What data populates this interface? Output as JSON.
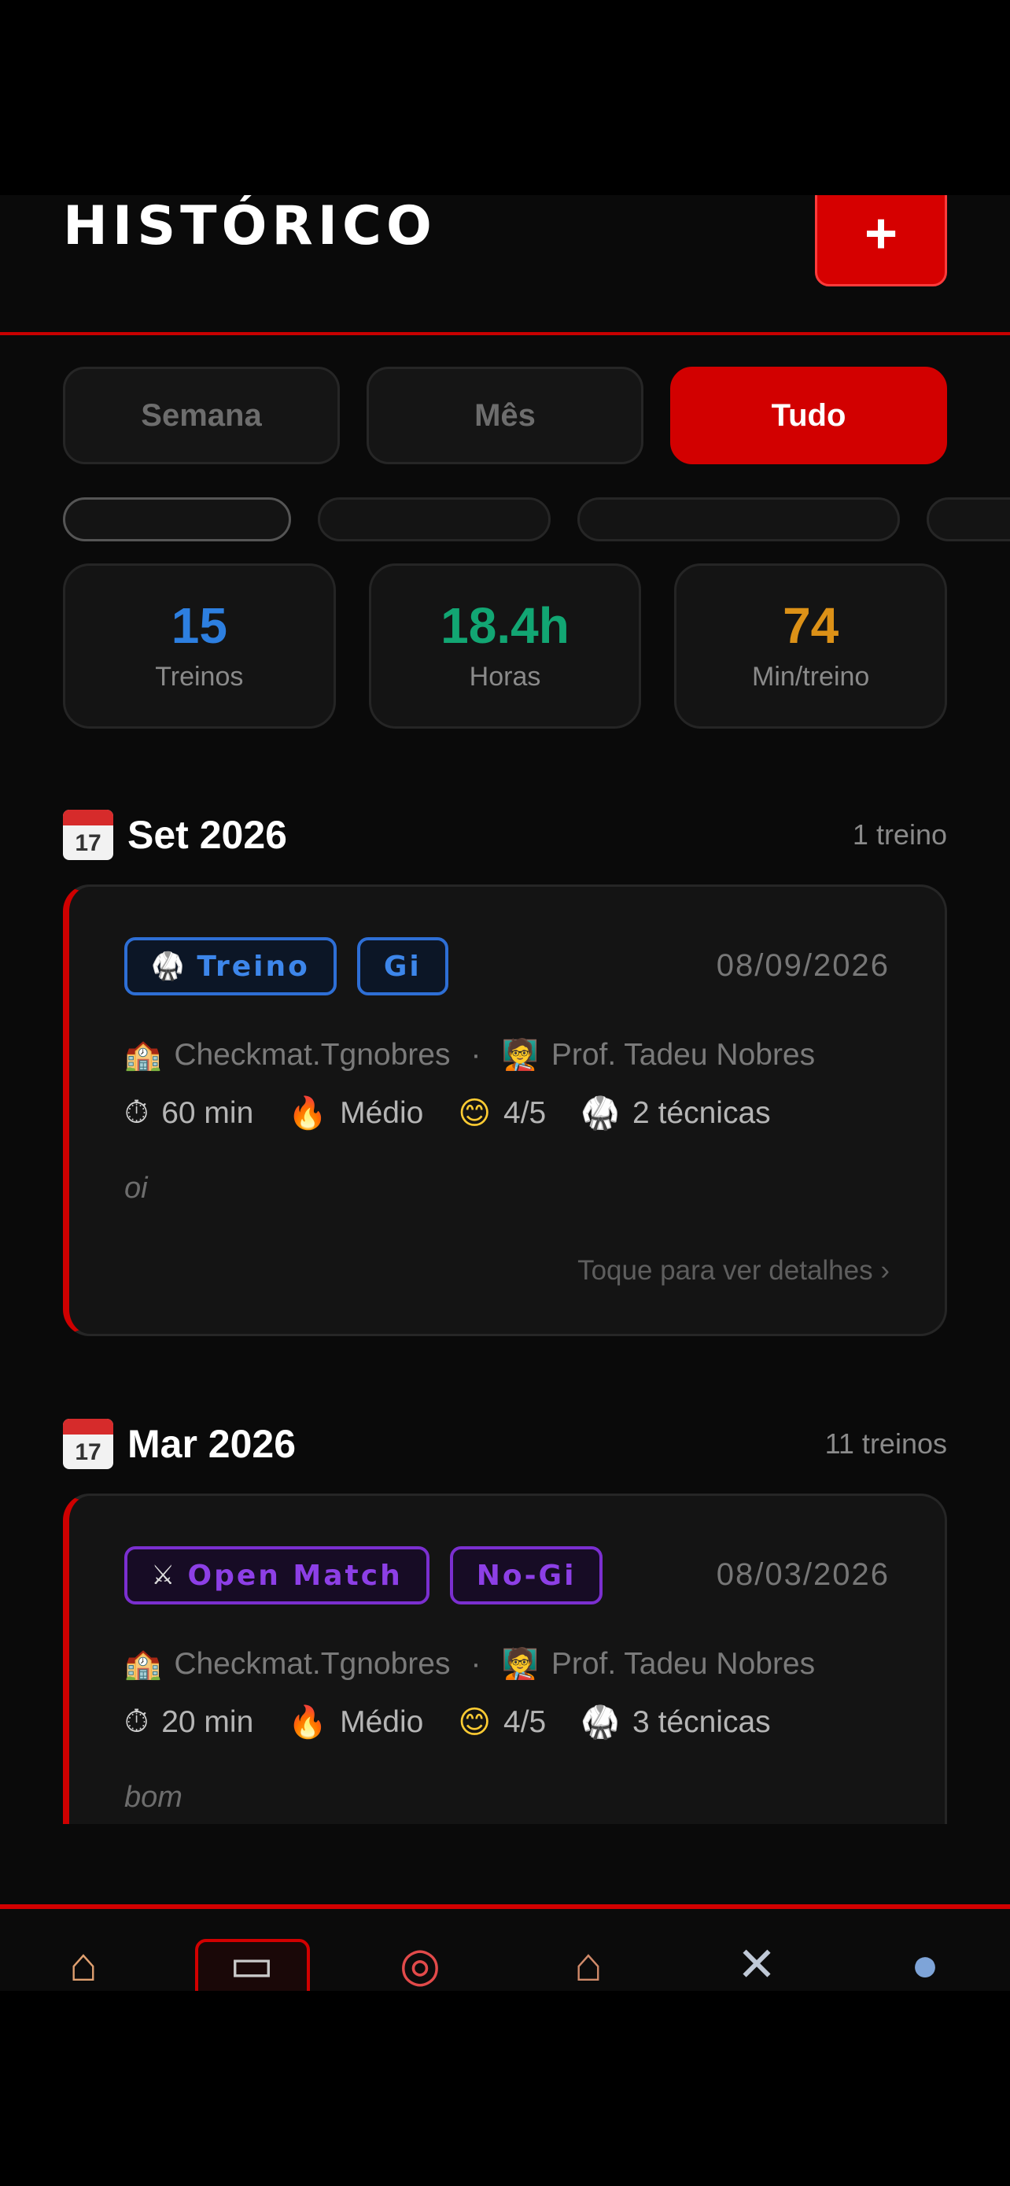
{
  "header": {
    "title": "HISTÓRICO",
    "add_label": "+"
  },
  "tabs": [
    {
      "label": "Semana"
    },
    {
      "label": "Mês"
    },
    {
      "label": "Tudo"
    }
  ],
  "stats": [
    {
      "value": "15",
      "label": "Treinos",
      "color": "#2d7fe0"
    },
    {
      "value": "18.4h",
      "label": "Horas",
      "color": "#12a673"
    },
    {
      "value": "74",
      "label": "Min/treino",
      "color": "#dc9117"
    }
  ],
  "sections": [
    {
      "calendar_icon": "JUL 17",
      "month": "Set 2026",
      "count": "1 treino",
      "card": {
        "type_badge": "Treino",
        "type_icon": "gi-icon",
        "style_badge": "Gi",
        "date": "08/09/2026",
        "academy": "Checkmat.Tgnobres",
        "separator": "·",
        "professor": "Prof. Tadeu Nobres",
        "duration": "60 min",
        "intensity": "Médio",
        "rating": "4/5",
        "techniques": "2 técnicas",
        "note": "oi",
        "details": "Toque para ver detalhes ›"
      }
    },
    {
      "calendar_icon": "JUL 17",
      "month": "Mar 2026",
      "count": "11 treinos",
      "card": {
        "type_badge": "Open Match",
        "type_icon": "crossed-swords-icon",
        "style_badge": "No-Gi",
        "date": "08/03/2026",
        "academy": "Checkmat.Tgnobres",
        "separator": "·",
        "professor": "Prof. Tadeu Nobres",
        "duration": "20 min",
        "intensity": "Médio",
        "rating": "4/5",
        "techniques": "3 técnicas",
        "note": "bom"
      }
    }
  ],
  "nav": [
    {
      "icon": "home-icon",
      "glyph": "⌂"
    },
    {
      "icon": "clipboard-icon",
      "glyph": "▭"
    },
    {
      "icon": "target-icon",
      "glyph": "◎"
    },
    {
      "icon": "academy-icon",
      "glyph": "⌂"
    },
    {
      "icon": "swords-icon",
      "glyph": "✕"
    },
    {
      "icon": "profile-icon",
      "glyph": "●"
    }
  ],
  "colors": {
    "accent": "#d20000",
    "background": "#0a0a0a"
  }
}
